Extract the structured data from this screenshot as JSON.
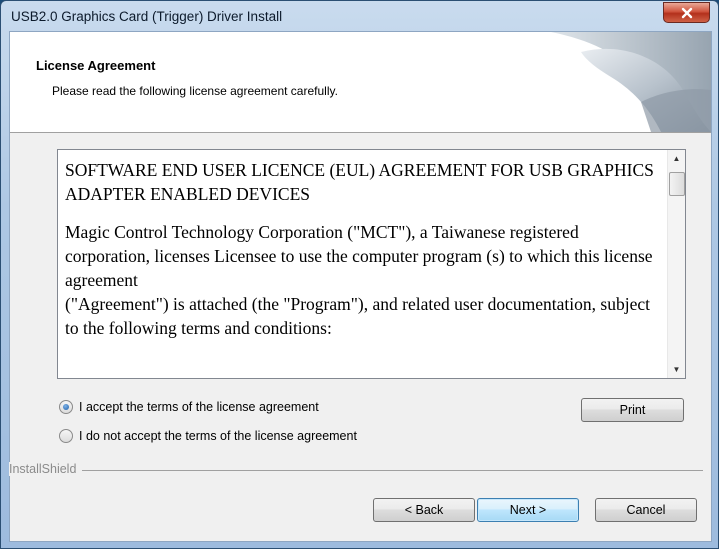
{
  "window": {
    "title": "USB2.0 Graphics Card (Trigger) Driver Install",
    "close_icon": "close-icon"
  },
  "header": {
    "title": "License Agreement",
    "subtitle": "Please read the following license agreement carefully.",
    "graphic_icon": "installshield-swoosh-graphic"
  },
  "license": {
    "paragraphs": [
      "SOFTWARE END USER LICENCE (EUL) AGREEMENT FOR USB GRAPHICS ADAPTER ENABLED DEVICES",
      "Magic Control Technology Corporation (\"MCT\"), a Taiwanese registered corporation, licenses Licensee to use the computer program (s) to which this license agreement",
      "(\"Agreement\") is attached (the \"Program\"), and related user documentation, subject to the following terms and conditions:"
    ],
    "scroll_up_glyph": "▲",
    "scroll_down_glyph": "▼"
  },
  "options": {
    "accept_label": "I accept the terms of the license agreement",
    "decline_label": "I do not accept the terms of the license agreement",
    "selected": "accept"
  },
  "buttons": {
    "print": "Print",
    "back": "< Back",
    "next": "Next >",
    "cancel": "Cancel"
  },
  "footer": {
    "brand": "InstallShield"
  },
  "colors": {
    "titlebar": "#aec8e4",
    "close_button": "#c8432d",
    "default_button_border": "#3c7fb1"
  }
}
